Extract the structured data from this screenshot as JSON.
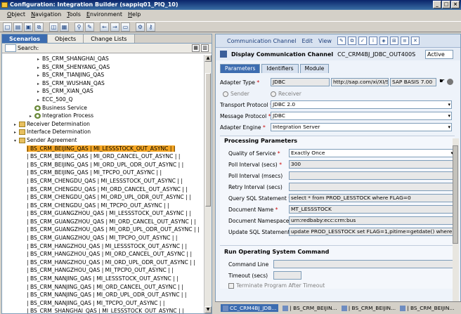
{
  "window": {
    "title": "Configuration: Integration Builder (sappiq01_PIQ_10)"
  },
  "menu": [
    "Object",
    "Navigation",
    "Tools",
    "Environment",
    "Help"
  ],
  "left": {
    "tabs": [
      "Scenarios",
      "Objects",
      "Change Lists"
    ],
    "search_label": "Search:",
    "tree": [
      {
        "indent": 4,
        "exp": "▸",
        "text": "BS_CRM_SHANGHAI_QAS"
      },
      {
        "indent": 4,
        "exp": "▸",
        "text": "BS_CRM_SHENYANG_QAS"
      },
      {
        "indent": 4,
        "exp": "▸",
        "text": "BS_CRM_TIANJING_QAS"
      },
      {
        "indent": 4,
        "exp": "▸",
        "text": "BS_CRM_WUSHAN_QAS"
      },
      {
        "indent": 4,
        "exp": "▸",
        "text": "BS_CRM_XIAN_QAS"
      },
      {
        "indent": 4,
        "exp": "▸",
        "text": "ECC_500_Q"
      },
      {
        "indent": 3,
        "exp": "",
        "icon": "gear",
        "text": "Business Service"
      },
      {
        "indent": 3,
        "exp": "▸",
        "icon": "gear",
        "text": "Integration Process"
      },
      {
        "indent": 1,
        "exp": "▸",
        "icon": "folder",
        "text": "Receiver Determination"
      },
      {
        "indent": 1,
        "exp": "▸",
        "icon": "folder",
        "text": "Interface Determination"
      },
      {
        "indent": 1,
        "exp": "▾",
        "icon": "folder",
        "text": "Sender Agreement"
      },
      {
        "indent": 2,
        "exp": "",
        "text": "| BS_CRM_BEIJING_QAS | MI_LESSSTOCK_OUT_ASYNC | |",
        "sel": true
      },
      {
        "indent": 2,
        "exp": "",
        "text": "| BS_CRM_BEIJING_QAS | MI_ORD_CANCEL_OUT_ASYNC | |"
      },
      {
        "indent": 2,
        "exp": "",
        "text": "| BS_CRM_BEIJING_QAS | MI_ORD_UPL_ODR_OUT_ASYNC | |"
      },
      {
        "indent": 2,
        "exp": "",
        "text": "| BS_CRM_BEIJING_QAS | MI_TPCPO_OUT_ASYNC | |"
      },
      {
        "indent": 2,
        "exp": "",
        "text": "| BS_CRM_CHENGDU_QAS | MI_LESSSTOCK_OUT_ASYNC | |"
      },
      {
        "indent": 2,
        "exp": "",
        "text": "| BS_CRM_CHENGDU_QAS | MI_ORD_CANCEL_OUT_ASYNC | |"
      },
      {
        "indent": 2,
        "exp": "",
        "text": "| BS_CRM_CHENGDU_QAS | MI_ORD_UPL_ODR_OUT_ASYNC | |"
      },
      {
        "indent": 2,
        "exp": "",
        "text": "| BS_CRM_CHENGDU_QAS | MI_TPCPO_OUT_ASYNC | |"
      },
      {
        "indent": 2,
        "exp": "",
        "text": "| BS_CRM_GUANGZHOU_QAS | MI_LESSSTOCK_OUT_ASYNC | |"
      },
      {
        "indent": 2,
        "exp": "",
        "text": "| BS_CRM_GUANGZHOU_QAS | MI_ORD_CANCEL_OUT_ASYNC | |"
      },
      {
        "indent": 2,
        "exp": "",
        "text": "| BS_CRM_GUANGZHOU_QAS | MI_ORD_UPL_ODR_OUT_ASYNC | |"
      },
      {
        "indent": 2,
        "exp": "",
        "text": "| BS_CRM_GUANGZHOU_QAS | MI_TPCPO_OUT_ASYNC | |"
      },
      {
        "indent": 2,
        "exp": "",
        "text": "| BS_CRM_HANGZHOU_QAS | MI_LESSSTOCK_OUT_ASYNC | |"
      },
      {
        "indent": 2,
        "exp": "",
        "text": "| BS_CRM_HANGZHOU_QAS | MI_ORD_CANCEL_OUT_ASYNC | |"
      },
      {
        "indent": 2,
        "exp": "",
        "text": "| BS_CRM_HANGZHOU_QAS | MI_ORD_UPL_ODR_OUT_ASYNC | |"
      },
      {
        "indent": 2,
        "exp": "",
        "text": "| BS_CRM_HANGZHOU_QAS | MI_TPCPO_OUT_ASYNC | |"
      },
      {
        "indent": 2,
        "exp": "",
        "text": "| BS_CRM_NANJING_QAS | MI_LESSSTOCK_OUT_ASYNC | |"
      },
      {
        "indent": 2,
        "exp": "",
        "text": "| BS_CRM_NANJING_QAS | MI_ORD_CANCEL_OUT_ASYNC | |"
      },
      {
        "indent": 2,
        "exp": "",
        "text": "| BS_CRM_NANJING_QAS | MI_ORD_UPL_ODR_OUT_ASYNC | |"
      },
      {
        "indent": 2,
        "exp": "",
        "text": "| BS_CRM_NANJING_QAS | MI_TPCPO_OUT_ASYNC | |"
      },
      {
        "indent": 2,
        "exp": "",
        "text": "| BS_CRM_SHANGHAI_QAS | MI_LESSSTOCK_OUT_ASYNC | |"
      }
    ]
  },
  "right": {
    "menu": [
      "Communication Channel",
      "Edit",
      "View"
    ],
    "header_title": "Display Communication Channel",
    "header_name": "CC_CRM4BJ_JDBC_OUT400S",
    "status": "Active",
    "tabs": [
      "Parameters",
      "Identifiers",
      "Module"
    ],
    "adapter_type_label": "Adapter Type",
    "adapter_type": "JDBC",
    "adapter_ns": "http://sap.com/xi/XI/System",
    "adapter_sw": "SAP BASIS 7.00",
    "sender_label": "Sender",
    "receiver_label": "Receiver",
    "transport_label": "Transport Protocol",
    "transport": "JDBC 2.0",
    "message_label": "Message Protocol",
    "message": "JDBC",
    "engine_label": "Adapter Engine",
    "engine": "Integration Server",
    "processing_title": "Processing Parameters",
    "qos_label": "Quality of Service",
    "qos": "Exactly Once",
    "poll_label": "Poll Interval (secs)",
    "poll": "300",
    "pollms_label": "Poll Interval (msecs)",
    "pollms": "",
    "retry_label": "Retry Interval (secs)",
    "retry": "",
    "query_label": "Query SQL Statement",
    "query": "select * from PROD_LESSTOCK where FLAG=0",
    "docname_label": "Document Name",
    "docname": "MT_LESSSTOCK",
    "docns_label": "Document Namespace",
    "docns": "urn:redbaby:ecc:crm:bus",
    "update_label": "Update SQL Statement",
    "update": "update PROD_LESSTOCK set FLAG=1,pitime=getdate()  where FLAG=0",
    "runos_title": "Run Operating System Command",
    "cmdline_label": "Command Line",
    "timeout_label": "Timeout (secs)",
    "terminate_label": "Terminate Program After Timeout",
    "bottom_tabs": [
      "CC_CRM4BJ_JDB...",
      "| BS_CRM_BEIJIN...",
      "| BS_CRM_BEIJIN...",
      "| BS_CRM_BEIJIN..."
    ]
  }
}
